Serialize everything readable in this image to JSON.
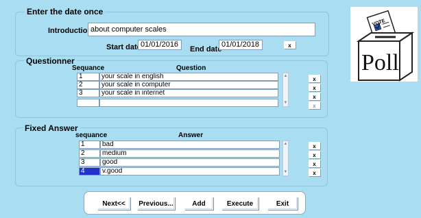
{
  "date_section": {
    "title": "Enter the date once",
    "introduction_label": "Introduction",
    "introduction_value": "about computer scales",
    "start_date_label": "Start date",
    "start_date_value": "01/01/2016",
    "end_date_label": "End date",
    "end_date_value": "01/01/2018",
    "clear_label": "x"
  },
  "questionner": {
    "title": "Questionner",
    "col_sequence": "Sequance",
    "col_question": "Question",
    "rows": [
      {
        "seq": "1",
        "text": "your scale in english"
      },
      {
        "seq": "2",
        "text": "your scale in computer"
      },
      {
        "seq": "3",
        "text": "your scale in internet"
      },
      {
        "seq": "",
        "text": ""
      }
    ],
    "delete_label": "x"
  },
  "fixed_answer": {
    "title": "Fixed Answer",
    "col_sequence": "sequance",
    "col_answer": "Answer",
    "rows": [
      {
        "seq": "1",
        "text": "bad"
      },
      {
        "seq": "2",
        "text": "medium"
      },
      {
        "seq": "3",
        "text": "good"
      },
      {
        "seq": "4",
        "text": "v.good"
      }
    ],
    "delete_label": "x"
  },
  "buttons": {
    "next": "Next<<",
    "previous": "Previous...",
    "add": "Add",
    "execute": "Execute",
    "exit": "Exit"
  },
  "poll_image": {
    "vote_text": "VOTE",
    "poll_text": "Poll"
  },
  "colors": {
    "background": "#a9ddf1",
    "selection": "#2233cc"
  }
}
